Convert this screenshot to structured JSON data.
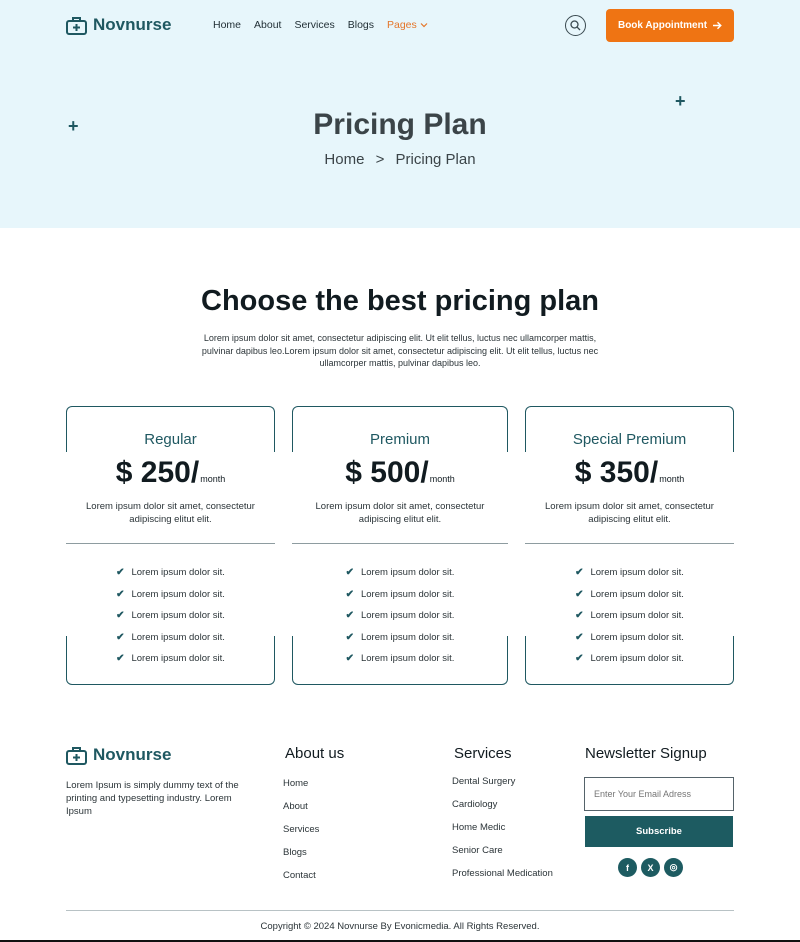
{
  "header": {
    "brand": "Novnurse",
    "nav": [
      {
        "label": "Home"
      },
      {
        "label": "About"
      },
      {
        "label": "Services"
      },
      {
        "label": "Blogs"
      },
      {
        "label": "Pages"
      }
    ],
    "cta_label": "Book Appointment",
    "accent_color": "#ef7413",
    "brand_color": "#1f5861"
  },
  "hero": {
    "title": "Pricing Plan",
    "breadcrumb": [
      "Home",
      ">",
      "Pricing Plan"
    ]
  },
  "pricing": {
    "title": "Choose the best pricing plan",
    "description": "Lorem ipsum dolor sit amet, consectetur adipiscing elit. Ut elit tellus, luctus nec ullamcorper mattis, pulvinar dapibus leo.Lorem ipsum dolor sit amet, consectetur adipiscing elit. Ut elit tellus, luctus nec ullamcorper mattis, pulvinar dapibus leo.",
    "plans": [
      {
        "name": "Regular",
        "price": "$ 250/",
        "period": "month",
        "description": "Lorem ipsum dolor sit amet, consectetur adipiscing elitut elit.",
        "features": [
          "Lorem ipsum dolor sit.",
          "Lorem ipsum dolor sit.",
          "Lorem ipsum dolor sit.",
          "Lorem ipsum dolor sit.",
          "Lorem ipsum dolor sit."
        ]
      },
      {
        "name": "Premium",
        "price": "$ 500/",
        "period": "month",
        "description": "Lorem ipsum dolor sit amet, consectetur adipiscing elitut elit.",
        "features": [
          "Lorem ipsum dolor sit.",
          "Lorem ipsum dolor sit.",
          "Lorem ipsum dolor sit.",
          "Lorem ipsum dolor sit.",
          "Lorem ipsum dolor sit."
        ]
      },
      {
        "name": "Special Premium",
        "price": "$ 350/",
        "period": "month",
        "description": "Lorem ipsum dolor sit amet, consectetur adipiscing elitut elit.",
        "features": [
          "Lorem ipsum dolor sit.",
          "Lorem ipsum dolor sit.",
          "Lorem ipsum dolor sit.",
          "Lorem ipsum dolor sit.",
          "Lorem ipsum dolor sit."
        ]
      }
    ]
  },
  "footer": {
    "brand": "Novnurse",
    "about_text": "Lorem Ipsum is simply dummy text of the printing and typesetting industry. Lorem Ipsum",
    "about_heading": "About us",
    "about_links": [
      "Home",
      "About",
      "Services",
      "Blogs",
      "Contact"
    ],
    "services_heading": "Services",
    "services_links": [
      "Dental Surgery",
      "Cardiology",
      "Home Medic",
      "Senior Care",
      "Professional Medication"
    ],
    "newsletter_heading": "Newsletter Signup",
    "email_placeholder": "Enter Your Email Adress",
    "subscribe_label": "Subscribe",
    "social": [
      {
        "icon": "facebook-icon",
        "glyph": "f"
      },
      {
        "icon": "x-icon",
        "glyph": "X"
      },
      {
        "icon": "instagram-icon",
        "glyph": "◎"
      }
    ],
    "copyright": "Copyright © 2024 Novnurse By Evonicmedia. All Rights Reserved."
  }
}
